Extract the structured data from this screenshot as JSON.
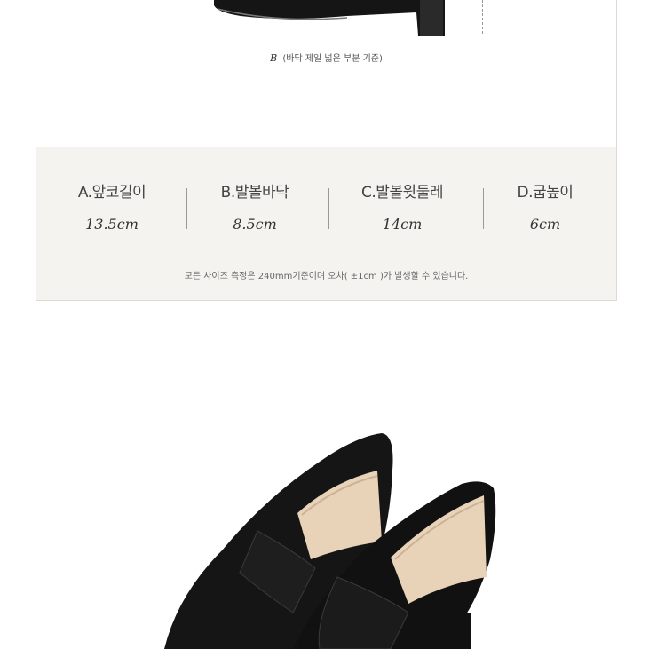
{
  "caption": {
    "letter": "B",
    "text": "(바닥 제일 넓은 부분 기준)"
  },
  "measurements": [
    {
      "label": "A.앞코길이",
      "value": "13.5cm"
    },
    {
      "label": "B.발볼바닥",
      "value": "8.5cm"
    },
    {
      "label": "C.발볼윗둘레",
      "value": "14cm"
    },
    {
      "label": "D.굽높이",
      "value": "6cm"
    }
  ],
  "note": "모든 사이즈 측정은 240mm기준이며 오차( ±1cm )가 발생할 수 있습니다.",
  "colors": {
    "panel_bg": "#f4f3ef",
    "shoe": "#151515",
    "lining": "#e8d2b8"
  }
}
